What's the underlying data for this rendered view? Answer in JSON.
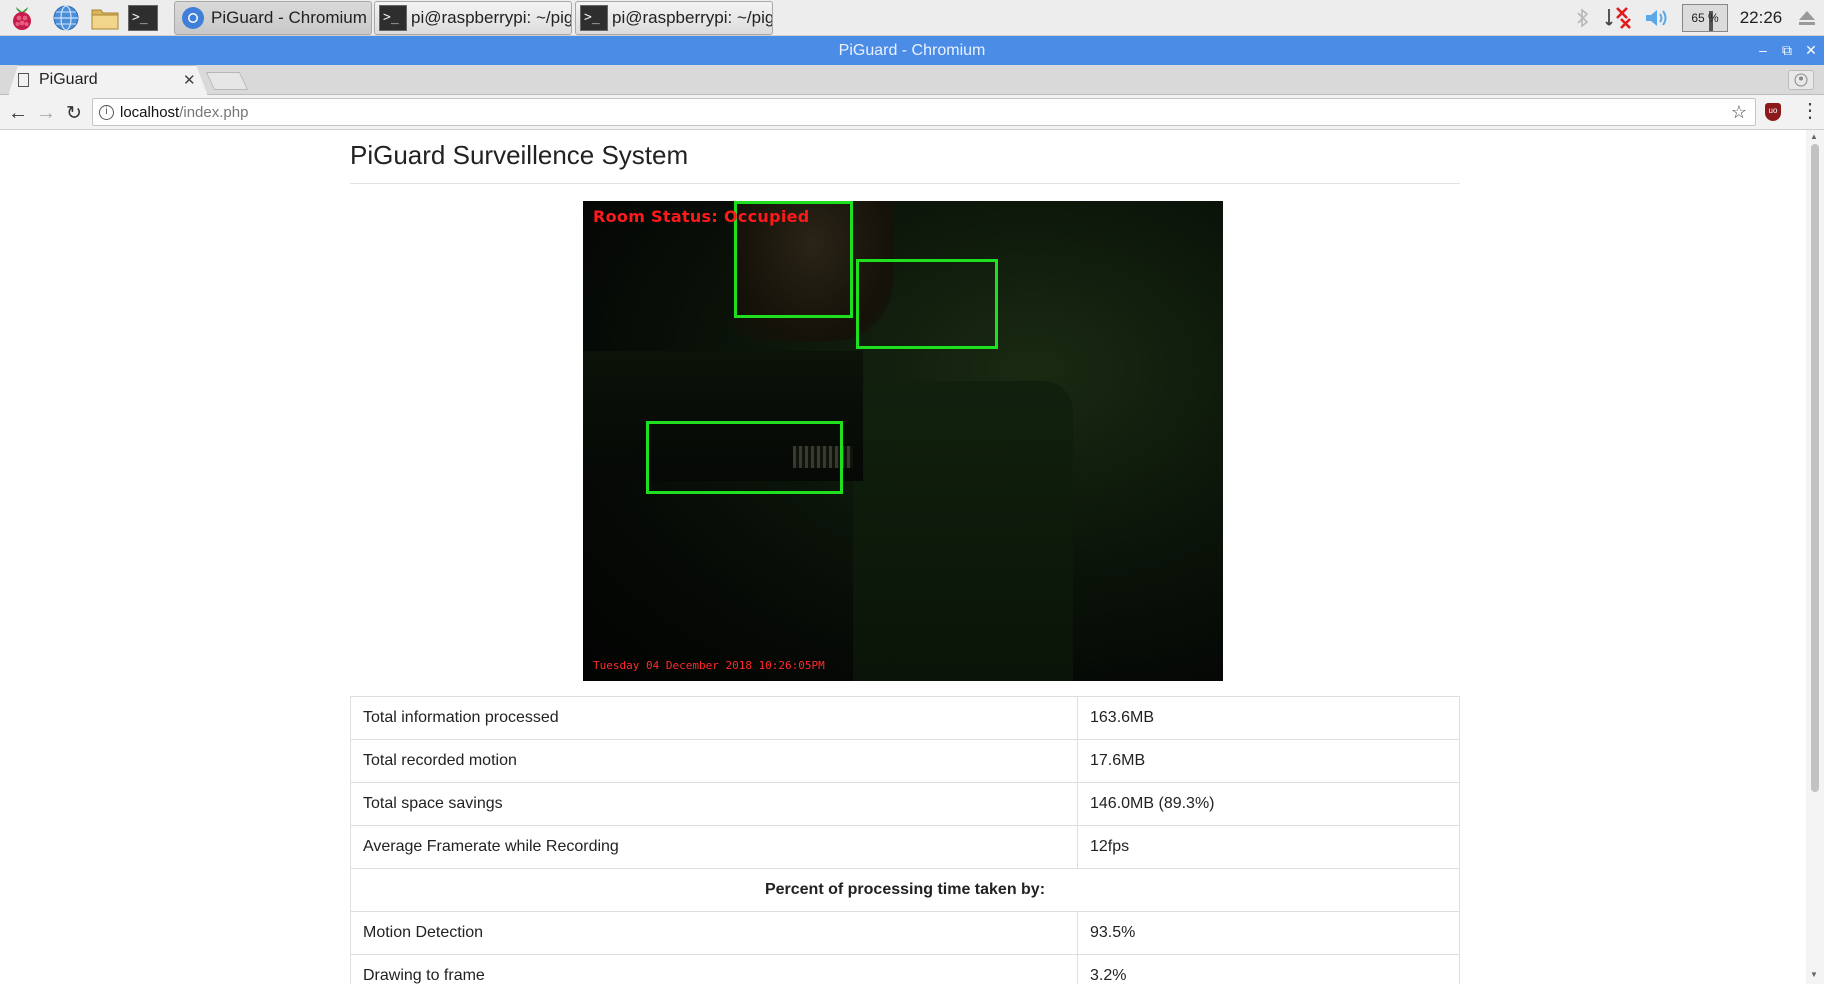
{
  "colors": {
    "taskbar_bg": "#ededed",
    "titlebar_bg": "#4b8de6",
    "motion_box": "#1fe01f",
    "overlay_text": "#ff1a1a"
  },
  "taskbar": {
    "launchers": [
      {
        "icon": "raspberry-menu-icon"
      },
      {
        "icon": "web-browser-icon"
      },
      {
        "icon": "file-manager-icon"
      },
      {
        "icon": "terminal-icon"
      }
    ],
    "tasks": [
      {
        "label": "PiGuard - Chromium",
        "icon": "chromium-icon",
        "active": true
      },
      {
        "label": "pi@raspberrypi: ~/pig...",
        "icon": "terminal-icon",
        "active": false
      },
      {
        "label": "pi@raspberrypi: ~/pig...",
        "icon": "terminal-icon",
        "active": false
      }
    ],
    "tray": {
      "cpu_label": "65 %",
      "clock": "22:26",
      "icons": [
        "bluetooth-icon",
        "network-disconnected-icon",
        "volume-icon",
        "eject-icon"
      ]
    }
  },
  "window": {
    "title": "PiGuard - Chromium"
  },
  "browser": {
    "tab": {
      "title": "PiGuard",
      "icon": "page-icon"
    },
    "url_host": "localhost",
    "url_path": "/index.php"
  },
  "page": {
    "title": "PiGuard Surveillence System",
    "camera": {
      "status_text": "Room Status: Occupied",
      "timestamp": "Tuesday 04 December 2018 10:26:05PM"
    },
    "stats": [
      {
        "label": "Total information processed",
        "value": "163.6MB"
      },
      {
        "label": "Total recorded motion",
        "value": "17.6MB"
      },
      {
        "label": "Total space savings",
        "value": "146.0MB (89.3%)"
      },
      {
        "label": "Average Framerate while Recording",
        "value": "12fps"
      }
    ],
    "section_header": "Percent of processing time taken by:",
    "processing": [
      {
        "label": "Motion Detection",
        "value": "93.5%"
      },
      {
        "label": "Drawing to frame",
        "value": "3.2%"
      }
    ]
  }
}
